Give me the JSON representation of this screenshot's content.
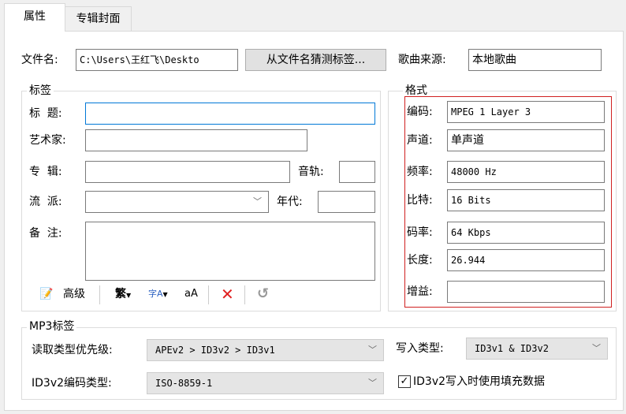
{
  "tabs": [
    {
      "label": "属性"
    },
    {
      "label": "专辑封面"
    }
  ],
  "file": {
    "label": "文件名:",
    "value": "C:\\Users\\王红飞\\Deskto",
    "guess_button": "从文件名猜测标签...",
    "source_label": "歌曲来源:",
    "source_value": "本地歌曲"
  },
  "tags": {
    "legend": "标签",
    "title_label": "标  题:",
    "title_value": "",
    "artist_label": "艺术家:",
    "artist_value": "",
    "album_label": "专  辑:",
    "album_value": "",
    "track_label": "音轨:",
    "track_value": "",
    "genre_label": "流  派:",
    "genre_value": "",
    "year_label": "年代:",
    "year_value": "",
    "comment_label": "备  注:",
    "comment_value": ""
  },
  "toolbar": {
    "advanced": "高级",
    "traditional": "繁",
    "translate": "字A",
    "case": "aA",
    "delete": "✕",
    "undo": "↺"
  },
  "format": {
    "legend": "格式",
    "fields": [
      {
        "label": "编码:",
        "value": "MPEG 1 Layer 3"
      },
      {
        "label": "声道:",
        "value": "单声道"
      },
      {
        "label": "频率:",
        "value": "48000 Hz"
      },
      {
        "label": "比特:",
        "value": "16 Bits"
      },
      {
        "label": "码率:",
        "value": "64 Kbps"
      },
      {
        "label": "长度:",
        "value": "26.944"
      },
      {
        "label": "增益:",
        "value": ""
      }
    ]
  },
  "mp3": {
    "legend": "MP3标签",
    "read_priority_label": "读取类型优先级:",
    "read_priority_value": "APEv2 > ID3v2 > ID3v1",
    "write_type_label": "写入类型:",
    "write_type_value": "ID3v1 & ID3v2",
    "encoding_label": "ID3v2编码类型:",
    "encoding_value": "ISO-8859-1",
    "padding_label": "ID3v2写入时使用填充数据",
    "padding_checked": true
  },
  "colors": {
    "highlight_border": "#d02020",
    "focus_border": "#0078d7"
  }
}
